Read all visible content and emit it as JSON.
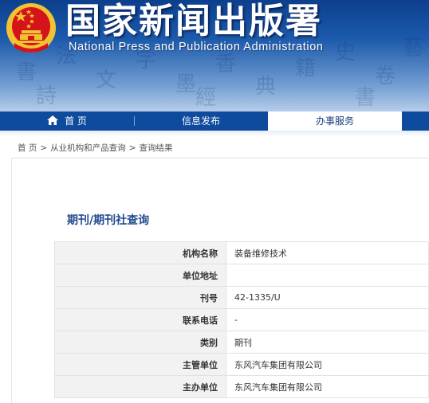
{
  "header": {
    "title_cn": "国家新闻出版署",
    "title_en": "National Press and Publication Administration",
    "emblem_icon": "national-emblem-icon"
  },
  "nav": {
    "items": [
      {
        "label": "首 页",
        "icon": "home-icon"
      },
      {
        "label": "信息发布"
      },
      {
        "label": "办事服务",
        "active": true
      }
    ]
  },
  "breadcrumb": [
    "首 页",
    "从业机构和产品查询",
    "查询结果"
  ],
  "breadcrumb_separator": ">",
  "page_title": "期刊/期刊社查询",
  "detail_rows": [
    {
      "key": "机构名称",
      "value": "装备维修技术"
    },
    {
      "key": "单位地址",
      "value": ""
    },
    {
      "key": "刊号",
      "value": "42-1335/U"
    },
    {
      "key": "联系电话",
      "value": "-"
    },
    {
      "key": "类别",
      "value": "期刊"
    },
    {
      "key": "主管单位",
      "value": "东风汽车集团有限公司"
    },
    {
      "key": "主办单位",
      "value": "东风汽车集团有限公司"
    }
  ],
  "colors": {
    "nav_bg": "#0e4a9d",
    "heading": "#224b8f",
    "label_bg": "#f2f2f2",
    "emblem_red": "#d4141a",
    "emblem_gold": "#f1c232"
  }
}
